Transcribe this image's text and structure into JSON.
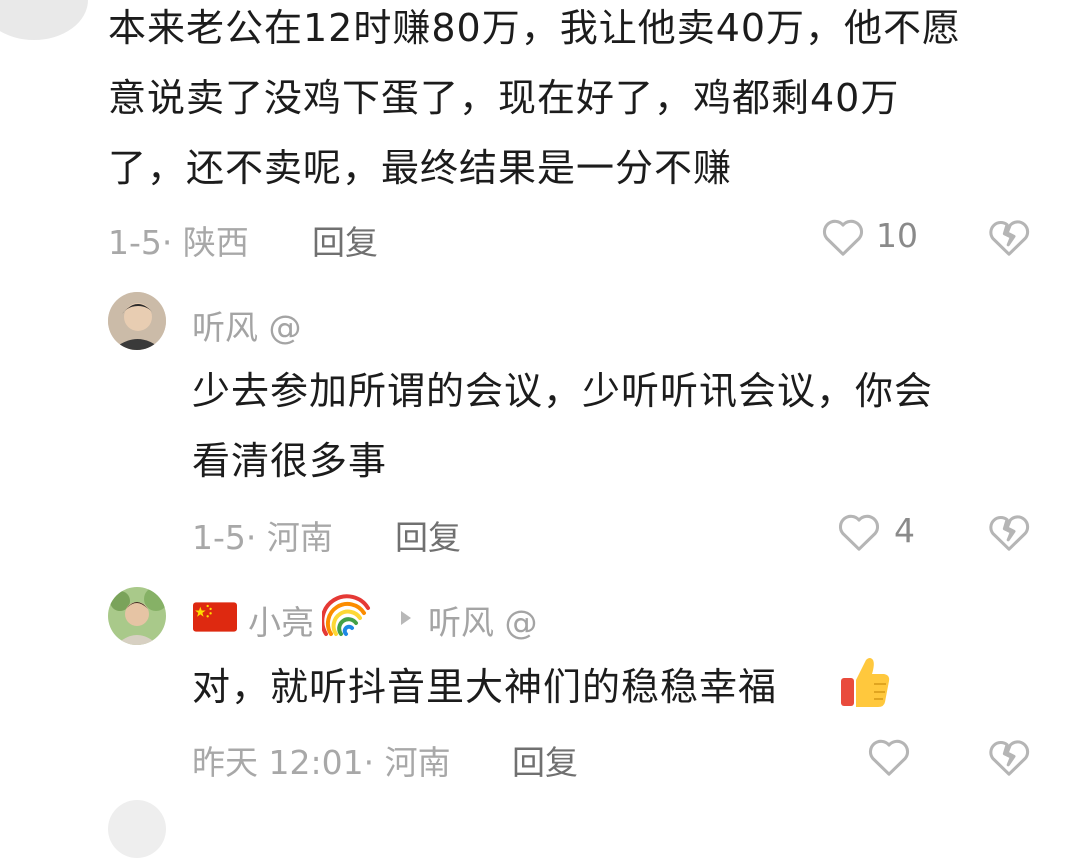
{
  "comment1": {
    "lines": [
      "本来老公在12时赚80万，我让他卖40万，他不愿",
      "意说卖了没鸡下蛋了，现在好了，鸡都剩40万",
      "了，还不卖呢，最终结果是一分不赚"
    ],
    "meta": "1-5· 陕西",
    "reply_label": "回复",
    "likes": "10"
  },
  "comment2": {
    "author": "听风 @",
    "lines": [
      "少去参加所谓的会议，少听听讯会议，你会",
      "看清很多事"
    ],
    "meta": "1-5· 河南",
    "reply_label": "回复",
    "likes": "4"
  },
  "comment3": {
    "author": "小亮",
    "reply_to": "听风 @",
    "text": "对，就听抖音里大神们的稳稳幸福",
    "meta": "昨天 12:01· 河南",
    "reply_label": "回复"
  },
  "colors": {
    "icon": "#b5b5b5",
    "flag": "#de2910"
  }
}
